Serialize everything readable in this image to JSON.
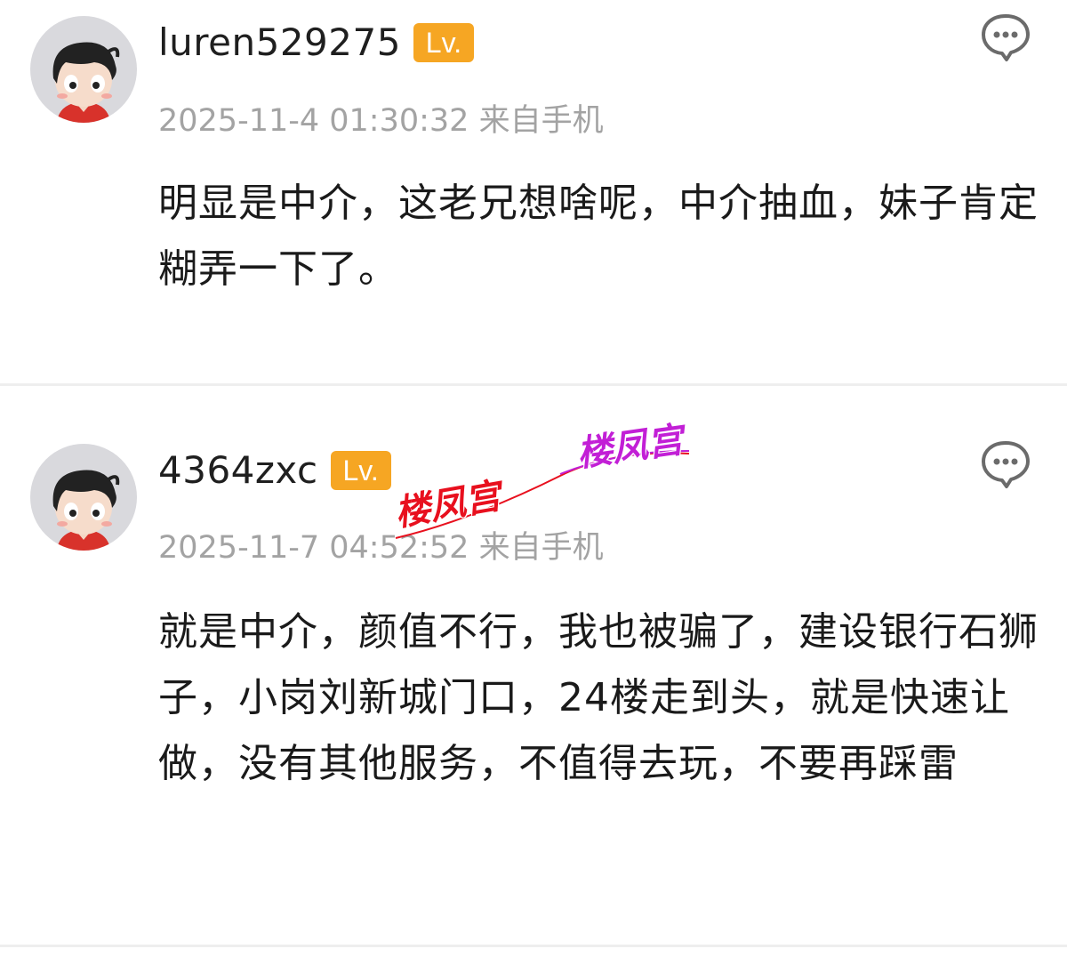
{
  "comments": [
    {
      "username": "luren529275",
      "level_label": "Lv.",
      "timestamp": "2025-11-4 01:30:32 来自手机",
      "text": "明显是中介，这老兄想啥呢，中介抽血，妹子肯定糊弄一下了。"
    },
    {
      "username": "4364zxc",
      "level_label": "Lv.",
      "timestamp": "2025-11-7 04:52:52 来自手机",
      "text": "就是中介，颜值不行，我也被骗了，建设银行石狮子，小岗刘新城门口，24楼走到头，就是快速让做，没有其他服务，不值得去玩，不要再踩雷"
    }
  ],
  "watermark": {
    "text_primary": "楼凤宫",
    "text_secondary": "楼凤宫",
    "color_primary": "#e8101e",
    "color_secondary": "#c21fd6"
  },
  "icons": {
    "reply": "comment-bubble-icon",
    "avatar": "default-cartoon-avatar"
  },
  "colors": {
    "badge": "#f6a623",
    "meta_text": "#a3a3a3",
    "divider": "#eeeeee"
  }
}
